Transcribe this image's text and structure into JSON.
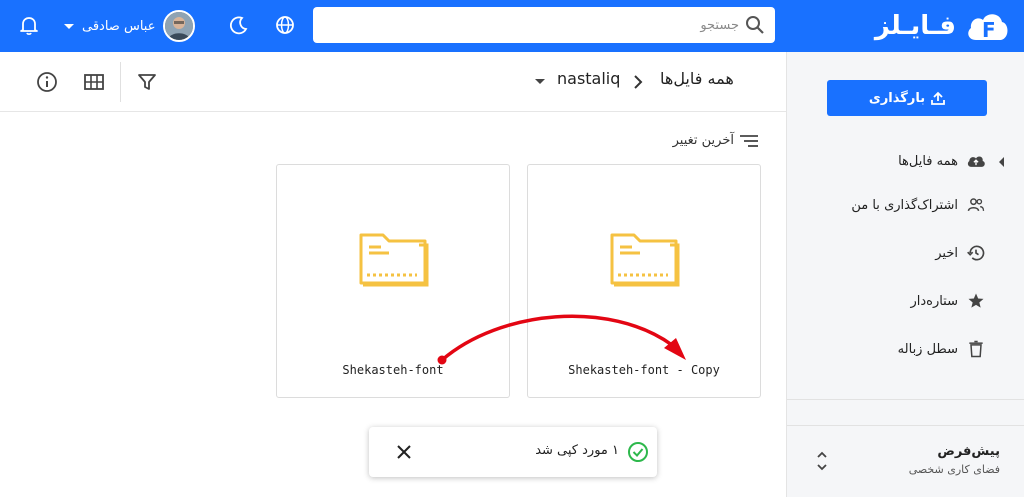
{
  "app": {
    "logo_text": "فـایـلز",
    "brand_color": "#1971ff"
  },
  "header": {
    "search_placeholder": "جستجو",
    "user_name": "عباس صادقی",
    "icons": [
      "search-icon",
      "globe-icon",
      "moon-icon",
      "bell-icon",
      "chevron-down-icon"
    ]
  },
  "toolbar": {
    "breadcrumb_root": "همه فایل‌ها",
    "breadcrumb_current": "nastaliq",
    "icons": [
      "filter-icon",
      "grid-view-icon",
      "info-icon"
    ]
  },
  "sort": {
    "label": "آخرین تغییر"
  },
  "files": [
    {
      "name": "Shekasteh-font - Copy",
      "type": "folder"
    },
    {
      "name": "Shekasteh-font",
      "type": "folder"
    }
  ],
  "sidebar": {
    "upload_label": "بارگذاری",
    "items": [
      {
        "label": "همه فایل‌ها",
        "icon": "cloud-upload-icon"
      },
      {
        "label": "اشتراک‌گذاری با من",
        "icon": "people-icon"
      },
      {
        "label": "اخیر",
        "icon": "history-icon"
      },
      {
        "label": "ستاره‌دار",
        "icon": "star-icon"
      },
      {
        "label": "سطل زباله",
        "icon": "trash-icon"
      }
    ],
    "workspace_title": "پیش‌فرض",
    "workspace_subtitle": "فضای کاری شخصی"
  },
  "toast": {
    "message": "۱ مورد کپی شد"
  },
  "colors": {
    "folder": "#f5c242",
    "annotation": "#e30613",
    "success": "#2db84c"
  }
}
